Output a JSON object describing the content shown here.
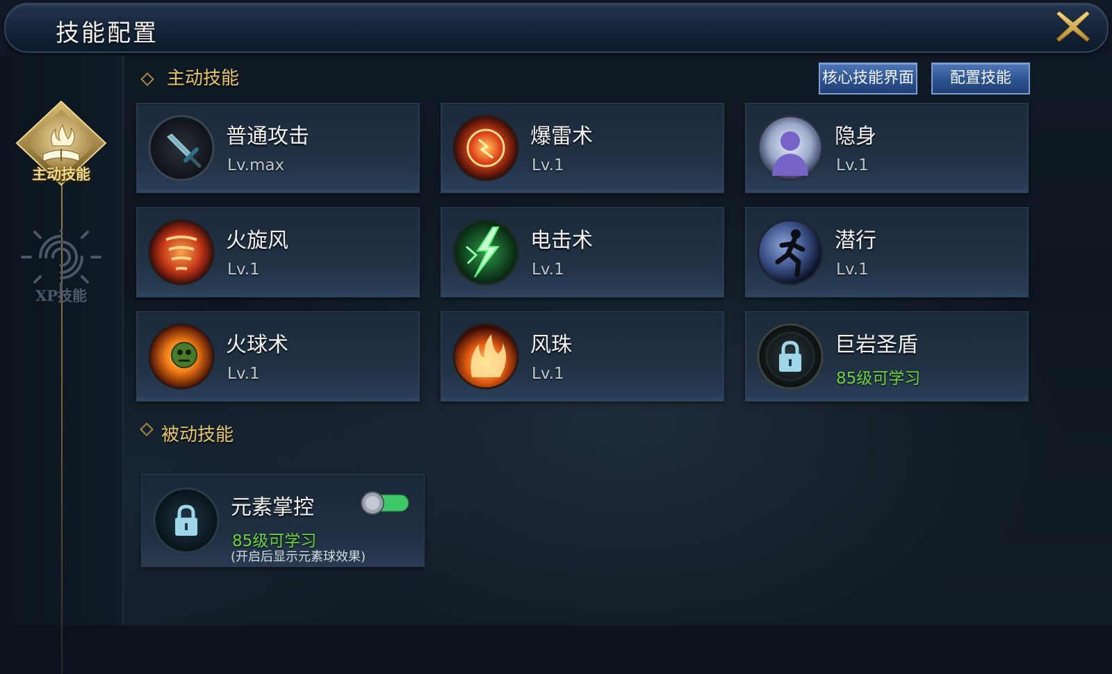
{
  "window": {
    "title": "技能配置"
  },
  "nav": {
    "tabs": [
      {
        "label": "主动技能",
        "active": true
      },
      {
        "label": "XP技能",
        "active": false
      }
    ]
  },
  "sections": {
    "active_title": "主动技能",
    "passive_title": "被动技能"
  },
  "buttons": {
    "core_skills": "核心技能界面",
    "configure": "配置技能"
  },
  "active_skills": [
    {
      "name": "普通攻击",
      "level": "Lv.max",
      "icon": "sword-icon"
    },
    {
      "name": "爆雷术",
      "level": "Lv.1",
      "icon": "thunder-burst-icon"
    },
    {
      "name": "隐身",
      "level": "Lv.1",
      "icon": "stealth-silhouette-icon"
    },
    {
      "name": "火旋风",
      "level": "Lv.1",
      "icon": "fire-whirlwind-icon"
    },
    {
      "name": "电击术",
      "level": "Lv.1",
      "icon": "lightning-icon"
    },
    {
      "name": "潜行",
      "level": "Lv.1",
      "icon": "running-figure-icon"
    },
    {
      "name": "火球术",
      "level": "Lv.1",
      "icon": "fireball-icon"
    },
    {
      "name": "风珠",
      "level": "Lv.1",
      "icon": "flame-orb-icon"
    },
    {
      "name": "巨岩圣盾",
      "level": "85级可学习",
      "icon": "lock-icon",
      "locked": true
    }
  ],
  "passive_skills": [
    {
      "name": "元素掌控",
      "level": "85级可学习",
      "hint": "(开启后显示元素球效果)",
      "icon": "lock-icon",
      "locked": true,
      "toggle_on": true
    }
  ],
  "colors": {
    "gold": "#e6c46c",
    "locked_green": "#6cd645",
    "button_blue": "#2d5390",
    "toggle_green": "#3ec86a"
  }
}
